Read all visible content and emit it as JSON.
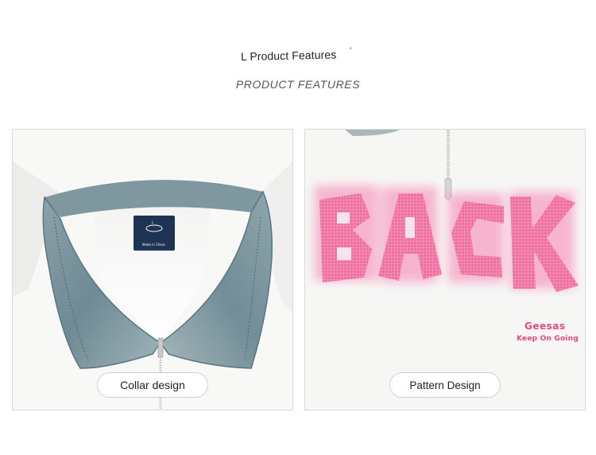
{
  "header": {
    "title": "L Product Features",
    "title_mark": "'",
    "subtitle": "PRODUCT FEATURES"
  },
  "panels": [
    {
      "caption": "Collar design",
      "label": {
        "size": "L",
        "origin": "Made in China"
      }
    },
    {
      "caption": "Pattern Design",
      "graphic": {
        "word": "BACK",
        "brand": "Geesas",
        "slogan": "Keep On Going"
      }
    }
  ],
  "colors": {
    "denim": "#7a929b",
    "denim_dark": "#5b7480",
    "pink": "#f36da0",
    "label_navy": "#1e3454",
    "zipper": "#c9c9c9"
  }
}
